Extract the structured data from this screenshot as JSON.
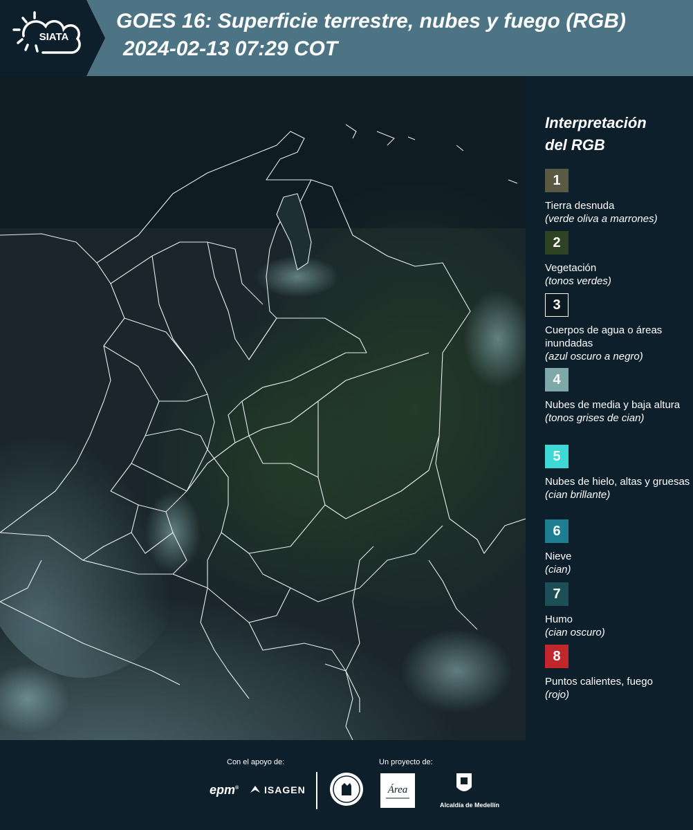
{
  "header": {
    "logo_text": "SIATA",
    "title": "GOES 16: Superficie terrestre, nubes y fuego (RGB)",
    "datetime": "2024-02-13 07:29 COT"
  },
  "legend": {
    "title_line1": "Interpretación",
    "title_line2": "del RGB",
    "items": [
      {
        "number": "1",
        "label": "Tierra desnuda",
        "sub": "(verde oliva a marrones)",
        "color": "#5a5a42"
      },
      {
        "number": "2",
        "label": "Vegetación",
        "sub": "(tonos verdes)",
        "color": "#2e4324"
      },
      {
        "number": "3",
        "label": "Cuerpos de agua o áreas inundadas",
        "sub": "(azul oscuro a negro)",
        "color": "#0d1a22"
      },
      {
        "number": "4",
        "label": "Nubes de media y baja altura",
        "sub": "(tonos grises de cian)",
        "color": "#7fa8a8"
      },
      {
        "number": "5",
        "label": "Nubes de hielo, altas y gruesas",
        "sub": "(cian brillante)",
        "color": "#3ed8d6"
      },
      {
        "number": "6",
        "label": "Nieve",
        "sub": "(cian)",
        "color": "#1e7f93"
      },
      {
        "number": "7",
        "label": "Humo",
        "sub": "(cian oscuro)",
        "color": "#1c4f56"
      },
      {
        "number": "8",
        "label": "Puntos calientes, fuego",
        "sub": "(rojo)",
        "color": "#c1262a"
      }
    ]
  },
  "footer": {
    "support_label": "Con el apoyo de:",
    "project_label": "Un proyecto de:",
    "epm": "epm",
    "isagen": "ISAGEN",
    "area_text": "Área",
    "alcaldia": "Alcaldía de Medellín"
  }
}
